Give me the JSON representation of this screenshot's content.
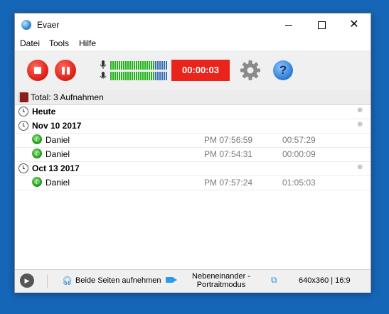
{
  "window": {
    "title": "Evaer"
  },
  "menu": [
    "Datei",
    "Tools",
    "Hilfe"
  ],
  "toolbar": {
    "timer": "00:00:03"
  },
  "list": {
    "total": "Total: 3 Aufnahmen",
    "groups": [
      {
        "label": "Heute",
        "items": []
      },
      {
        "label": "Nov 10 2017",
        "items": [
          {
            "name": "Daniel",
            "time": "PM 07:56:59",
            "duration": "00:57:29"
          },
          {
            "name": "Daniel",
            "time": "PM 07:54:31",
            "duration": "00:00:09"
          }
        ]
      },
      {
        "label": "Oct 13 2017",
        "items": [
          {
            "name": "Daniel",
            "time": "PM 07:57:24",
            "duration": "01:05:03"
          }
        ]
      }
    ]
  },
  "statusbar": {
    "record_both": "Beide Seiten aufnehmen",
    "layout_line1": "Nebeneinander -",
    "layout_line2": "Portraitmodus",
    "resolution": "640x360 | 16:9"
  },
  "colors": {
    "desktop": "#1666b8",
    "record": "#e1251b",
    "meter_on": "#22b31a",
    "meter_off": "#3b6fb5"
  },
  "icons": [
    "app-icon",
    "stop-icon",
    "pause-icon",
    "mic-icon",
    "gear-icon",
    "help-icon",
    "book-icon",
    "clock-icon",
    "call-icon",
    "play-icon",
    "headset-icon",
    "camera-icon",
    "zoom-icon"
  ]
}
